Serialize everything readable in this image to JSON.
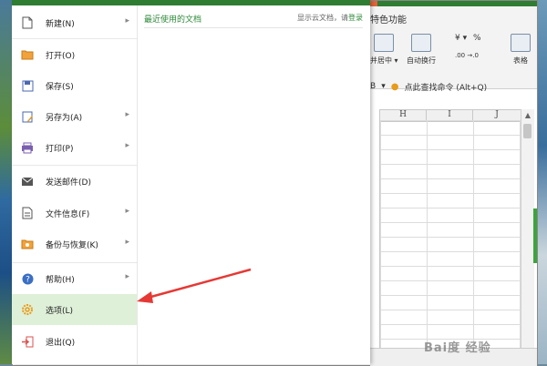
{
  "menu": {
    "items": [
      {
        "label": "新建(N)",
        "icon": "new-file-icon",
        "arrow": true
      },
      {
        "label": "打开(O)",
        "icon": "folder-open-icon",
        "arrow": false
      },
      {
        "label": "保存(S)",
        "icon": "save-icon",
        "arrow": false
      },
      {
        "label": "另存为(A)",
        "icon": "save-as-icon",
        "arrow": true
      },
      {
        "label": "打印(P)",
        "icon": "printer-icon",
        "arrow": true
      },
      {
        "label": "发送邮件(D)",
        "icon": "mail-icon",
        "arrow": false
      },
      {
        "label": "文件信息(F)",
        "icon": "file-info-icon",
        "arrow": true
      },
      {
        "label": "备份与恢复(K)",
        "icon": "backup-icon",
        "arrow": true
      },
      {
        "label": "帮助(H)",
        "icon": "help-icon",
        "arrow": true
      },
      {
        "label": "选项(L)",
        "icon": "gear-icon",
        "arrow": false,
        "selected": true
      },
      {
        "label": "退出(Q)",
        "icon": "exit-icon",
        "arrow": false
      }
    ],
    "recent_title": "最近使用的文档",
    "cloud_prefix": "显示云文档，请",
    "cloud_login": "登录"
  },
  "ribbon": {
    "tab_label": "特色功能",
    "merge_label": "并居中",
    "wrap_label": "自动换行",
    "percent_symbol": "%",
    "currency_symbol": "¥",
    "table_label": "表格",
    "search_command": "点此查找命令 (Alt+Q)"
  },
  "columns": [
    "H",
    "I",
    "J"
  ],
  "watermark": "Bai度 经验",
  "colors": {
    "accent_green": "#2e8a3a",
    "selected_bg": "#dff0d8",
    "arrow_red": "#e53935"
  }
}
